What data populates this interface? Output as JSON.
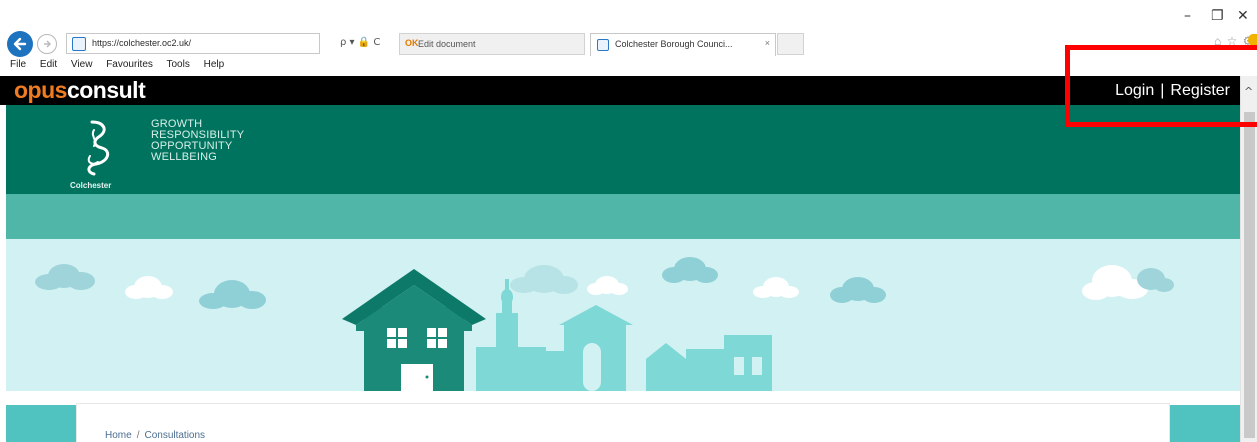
{
  "window": {
    "minimize_glyph": "–",
    "restore_glyph": "❐",
    "close_glyph": "✕"
  },
  "browser": {
    "address": "https://colchester.oc2.uk/",
    "address_controls": "ρ ▾ 🔒 C",
    "tabs": [
      {
        "label": "Edit document",
        "icon": "OK",
        "active": false
      },
      {
        "label": "Colchester Borough Counci...",
        "close": "×",
        "active": true
      }
    ],
    "toolbar_icons": "⌂ ☆ ⚙",
    "menu": [
      "File",
      "Edit",
      "View",
      "Favourites",
      "Tools",
      "Help"
    ]
  },
  "site": {
    "logo_opus": "opus",
    "logo_consult": "consult",
    "auth": {
      "login": "Login",
      "separator": "|",
      "register": "Register"
    }
  },
  "council": {
    "name": "Colchester",
    "tagline": [
      "GROWTH",
      "RESPONSIBILITY",
      "OPPORTUNITY",
      "WELLBEING"
    ]
  },
  "breadcrumb": {
    "items": [
      "Home",
      "Consultations"
    ],
    "separator": "/"
  },
  "colors": {
    "header_green": "#00735e",
    "nav_teal": "#4fb6a8",
    "hero_bg": "#d2f1f2",
    "house": "#1b8a79",
    "highlight": "#ff0000",
    "logo_orange": "#f07b21"
  },
  "scrollbar": {
    "up_glyph": "^"
  }
}
